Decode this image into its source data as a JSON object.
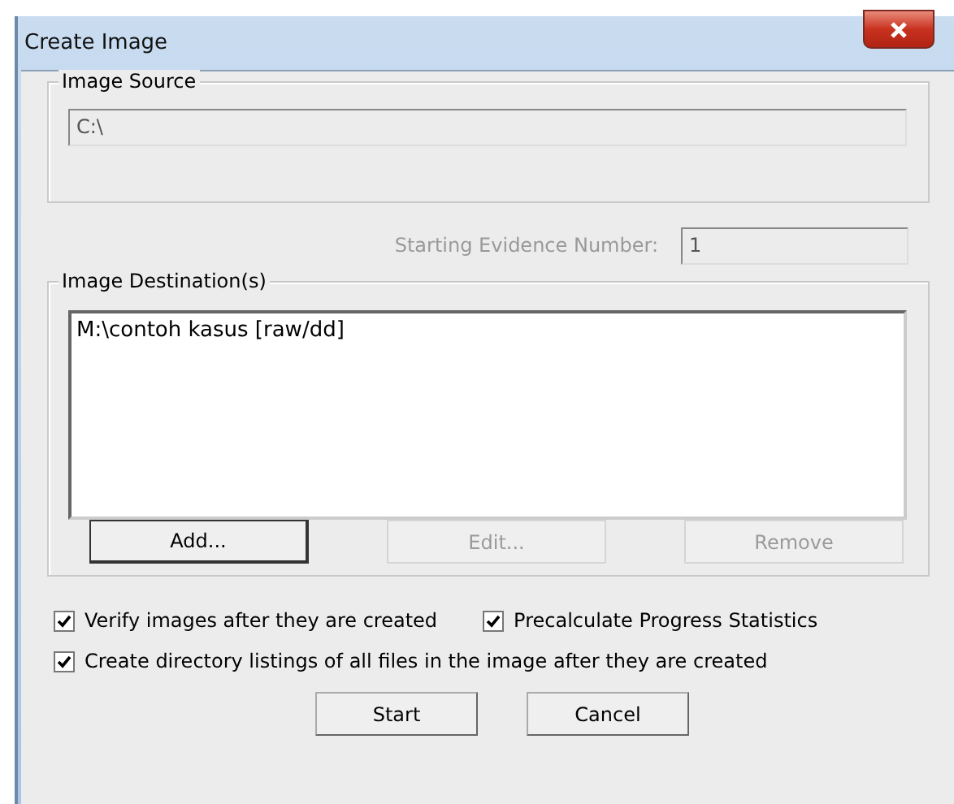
{
  "window": {
    "title": "Create Image"
  },
  "image_source": {
    "label": "Image Source",
    "value": "C:\\",
    "disabled": true
  },
  "starting_evidence": {
    "label": "Starting Evidence Number:",
    "value": "1",
    "disabled": true
  },
  "destinations": {
    "label": "Image Destination(s)",
    "items": [
      {
        "text": "M:\\contoh kasus [raw/dd]",
        "selected": false
      }
    ]
  },
  "destination_buttons": [
    {
      "label": "Add...",
      "disabled": false
    },
    {
      "label": "Edit...",
      "disabled": true
    },
    {
      "label": "Remove",
      "disabled": true
    }
  ],
  "options": [
    {
      "label": "Verify images after they are created",
      "checked": true
    },
    {
      "label": "Precalculate Progress Statistics",
      "checked": true
    },
    {
      "label": "Create directory listings of all files in the image after they are created",
      "checked": true
    }
  ],
  "buttons": [
    {
      "label": "Start"
    },
    {
      "label": "Cancel"
    }
  ]
}
